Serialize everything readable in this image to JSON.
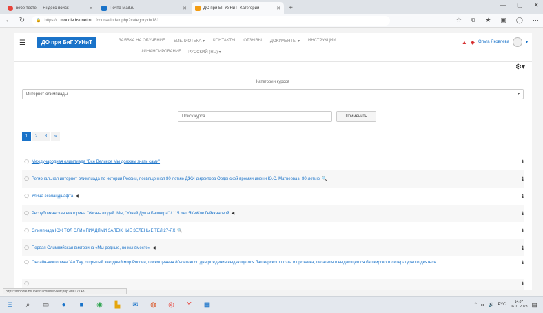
{
  "browser": {
    "tabs": [
      {
        "title": "вебе тесте — Яндекс поиск",
        "active": false,
        "color": "#e8433a"
      },
      {
        "title": "Почта Mail.ru",
        "active": false,
        "color": "#1a73c9"
      },
      {
        "title": "ДО при БГ УУНиТ: Категории",
        "active": true,
        "color": "#f39c12"
      }
    ],
    "url_prefix": "https://",
    "url_domain": "moodle.bsunet.ru",
    "url_path": "/course/index.php?categoryid=181"
  },
  "site": {
    "brand": "ДО при БиГ УУНиТ",
    "nav": [
      "ЗАЯВКА НА ОБУЧЕНИЕ",
      "БИБЛИОТЕКА ▾",
      "КОНТАКТЫ",
      "ОТЗЫВЫ",
      "ДОКУМЕНТЫ ▾",
      "ИНСТРУКЦИИ"
    ],
    "nav2": [
      "ФИНАНСИРОВАНИЕ",
      "РУССКИЙ (RU) ▾"
    ],
    "user_name": "Ольга Яковлева"
  },
  "main": {
    "categories_label": "Категории курсов",
    "category_selected": "Интернет-олимпиады",
    "search_placeholder": "Поиск курса",
    "apply_label": "Применить",
    "pages": [
      "1",
      "2",
      "3",
      "»"
    ]
  },
  "courses": [
    {
      "name": "Международная олимпиада \"Все Великое Мы должны знать сами\"",
      "extra": "",
      "underline": true
    },
    {
      "name": "Региональная интернет-олимпиада по истории России, посвященная 80-летию ДЖИ-директора Орденской премии имени Ю.С. Матвеева и 80-летию",
      "extra": "🔍",
      "underline": false
    },
    {
      "name": "Улица эколандшафта",
      "extra": "◀",
      "underline": false
    },
    {
      "name": "Республиканская викторина \"Жизнь людей. Мы, \"Узнай Душа Башкира\" / 115 лет ЯКвЖов Гейкхановой",
      "extra": "◀",
      "underline": false
    },
    {
      "name": "Олимпиада ЮЖ ТОЛ ОЛИМПИАДЯМИ ЗАЛЕЖНЫЕ ЗЕЛЕНЫЕ ТЕЛ 27-ЯХ",
      "extra": "🔍",
      "underline": false
    },
    {
      "name": "Первая Олимпийская викторина «Мы родные, но мы вместе»",
      "extra": "◀",
      "underline": false
    },
    {
      "name": "Онлайн-викторина \"Ал Тау, открытый звездный мир России, посвященная 80-летию со дня рождения выдающегося башкирского поэта и прозаика, писателя и выдающегося башкирского литературного деятеля",
      "extra": "",
      "underline": false
    },
    {
      "name": "",
      "extra": "",
      "underline": false
    }
  ],
  "status_url": "https://moodle.bsunet.ru/course/view.php?id=17748",
  "taskbar": {
    "time": "14:07",
    "date": "16.01.2023"
  }
}
